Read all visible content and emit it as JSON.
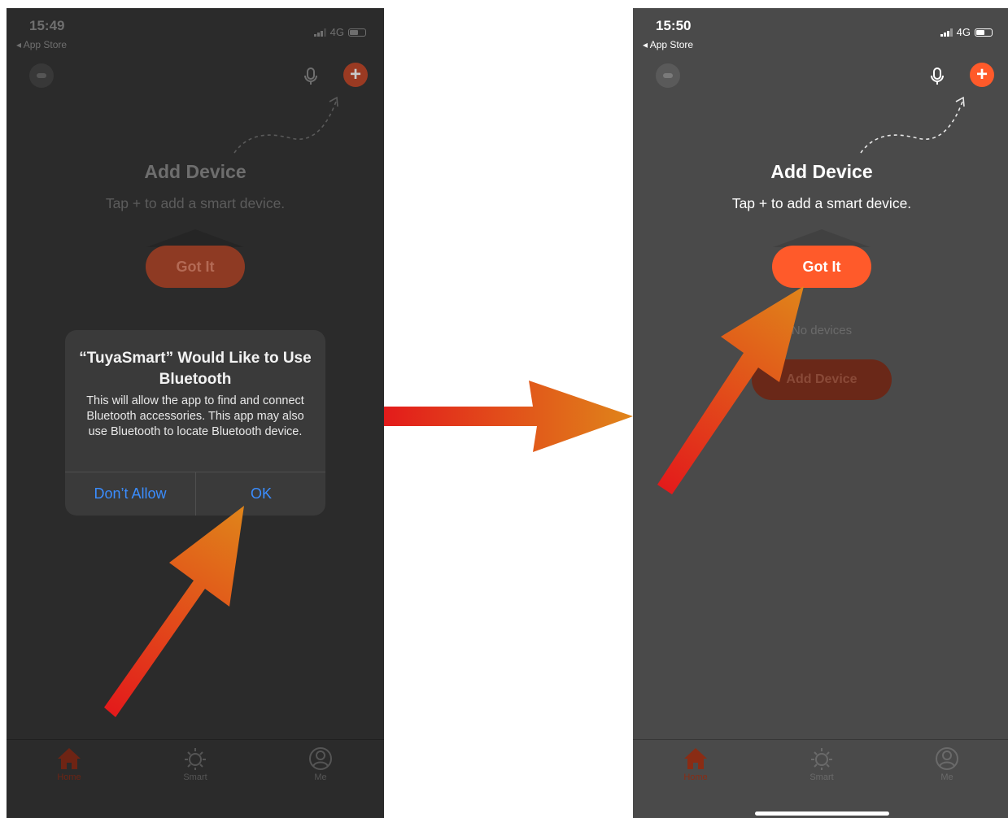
{
  "left_screen": {
    "status": {
      "time": "15:49",
      "back_label": "App Store",
      "network": "4G"
    },
    "empty_state": {
      "title": "Add Device",
      "subtitle": "Tap + to add a smart device.",
      "got_it": "Got It"
    },
    "dialog": {
      "title": "“TuyaSmart” Would Like to Use Bluetooth",
      "message": "This will allow the app to find and connect Bluetooth accessories. This app may also use Bluetooth to locate Bluetooth device.",
      "deny_label": "Don’t Allow",
      "ok_label": "OK"
    },
    "tabs": [
      {
        "label": "Home",
        "icon": "home-icon",
        "active": true
      },
      {
        "label": "Smart",
        "icon": "sun-icon",
        "active": false
      },
      {
        "label": "Me",
        "icon": "profile-icon",
        "active": false
      }
    ]
  },
  "right_screen": {
    "status": {
      "time": "15:50",
      "back_label": "App Store",
      "network": "4G"
    },
    "empty_state": {
      "title": "Add Device",
      "subtitle": "Tap + to add a smart device.",
      "got_it": "Got It",
      "no_devices": "No devices",
      "add_device_button": "Add Device"
    },
    "tabs": [
      {
        "label": "Home",
        "icon": "home-icon",
        "active": true
      },
      {
        "label": "Smart",
        "icon": "sun-icon",
        "active": false
      },
      {
        "label": "Me",
        "icon": "profile-icon",
        "active": false
      }
    ]
  },
  "colors": {
    "accent": "#ff5a2a",
    "ios_blue": "#3a8dff",
    "arrow_start": "#e31b1b",
    "arrow_end": "#e0851a"
  }
}
